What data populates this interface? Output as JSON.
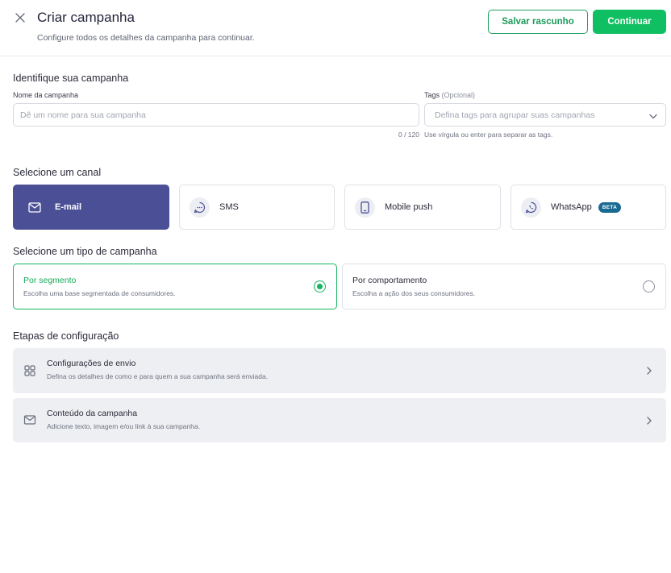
{
  "header": {
    "title": "Criar campanha",
    "subtitle": "Configure todos os detalhes da campanha para continuar.",
    "save_draft_label": "Salvar rascunho",
    "continue_label": "Continuar",
    "close_icon": "close-icon"
  },
  "identify": {
    "section_title": "Identifique sua campanha",
    "name_label": "Nome da campanha",
    "name_value": "",
    "name_placeholder": "Dê um nome para sua campanha",
    "name_counter": "0 / 120",
    "tags_label": "Tags",
    "tags_optional": "(Opcional)",
    "tags_placeholder": "Defina tags para agrupar suas campanhas",
    "tags_hint": "Use vírgula ou enter para separar as tags."
  },
  "channels": {
    "section_title": "Selecione um canal",
    "selected": "E-mail",
    "items": [
      {
        "label": "E-mail",
        "icon": "mail-icon",
        "active": true
      },
      {
        "label": "SMS",
        "icon": "chat-bubble-icon",
        "active": false
      },
      {
        "label": "Mobile push",
        "icon": "smartphone-icon",
        "active": false
      },
      {
        "label": "WhatsApp",
        "icon": "whatsapp-icon",
        "active": false,
        "badge": "BETA"
      }
    ]
  },
  "campaign_type": {
    "section_title": "Selecione um tipo de campanha",
    "options": [
      {
        "title": "Por segmento",
        "description": "Escolha uma base segmentada de consumidores.",
        "selected": true
      },
      {
        "title": "Por comportamento",
        "description": "Escolha a ação dos seus consumidores.",
        "selected": false
      }
    ]
  },
  "steps": {
    "section_title": "Etapas de configuração",
    "items": [
      {
        "title": "Configurações de envio",
        "description": "Defina os detalhes de como e para quem a sua campanha será enviada.",
        "icon": "grid-icon"
      },
      {
        "title": "Conteúdo da campanha",
        "description": "Adicione texto, imagem e/ou link à sua campanha.",
        "icon": "mail-icon"
      }
    ]
  },
  "colors": {
    "primary_green": "#0fbf61",
    "channel_active": "#4b4f95",
    "beta_badge": "#186a93",
    "step_background": "#eeeff2"
  }
}
